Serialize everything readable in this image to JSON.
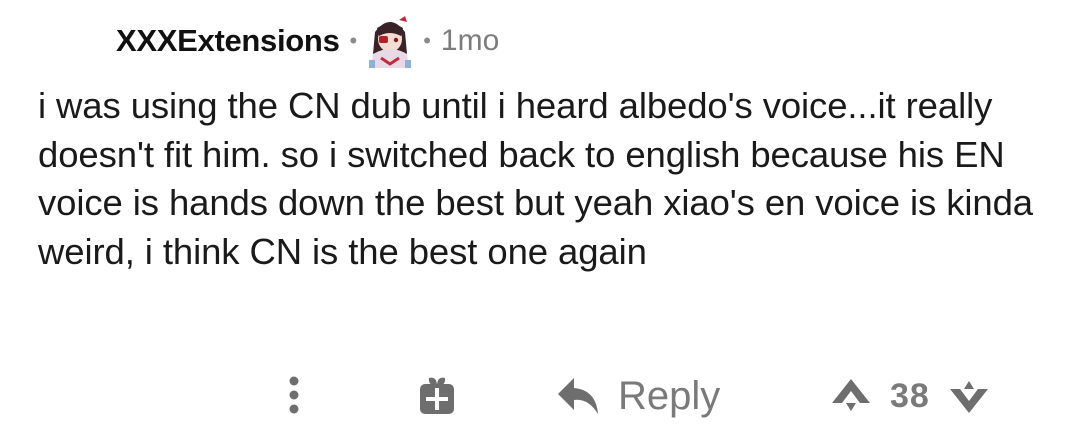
{
  "comment": {
    "username": "XXXExtensions",
    "separator": "•",
    "age": "1mo",
    "avatar_icon": "anime-avatar-icon",
    "body": "i was using the CN dub until i heard albedo's voice...it really doesn't fit him. so i switched back to english because his EN voice is hands down the best but yeah xiao's en voice is kinda weird, i think CN is the best one again"
  },
  "actions": {
    "more_icon": "more-vertical-icon",
    "award_icon": "gift-icon",
    "reply_icon": "reply-arrow-icon",
    "reply_label": "Reply",
    "upvote_icon": "upvote-arrow-icon",
    "score": "38",
    "downvote_icon": "downvote-arrow-icon"
  },
  "colors": {
    "text": "#1a1a1b",
    "muted": "#7a7a7a",
    "background": "#ffffff"
  }
}
